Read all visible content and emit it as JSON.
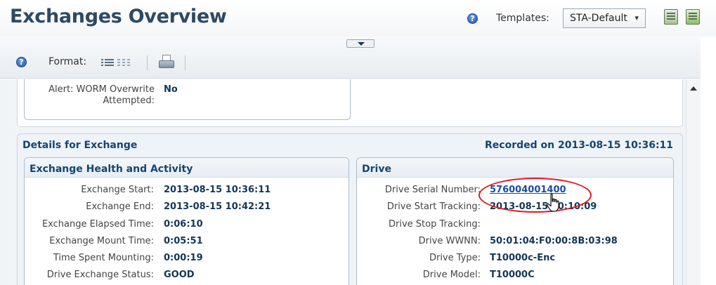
{
  "header": {
    "title": "Exchanges Overview",
    "help_icon": "question-circle",
    "templates_label": "Templates:",
    "template_selected": "STA-Default",
    "icons": [
      "report-icon",
      "report-export-icon"
    ]
  },
  "toolbar": {
    "format_label": "Format:",
    "icons": [
      "list-view-icon",
      "grid-view-icon",
      "print-icon"
    ]
  },
  "alert_panel": {
    "label": "Alert: WORM Overwrite Attempted:",
    "value": "No"
  },
  "details": {
    "title": "Details for Exchange",
    "recorded": "Recorded on 2013-08-15 10:36:11",
    "health": {
      "title": "Exchange Health and Activity",
      "rows": [
        {
          "label": "Exchange Start:",
          "value": "2013-08-15 10:36:11"
        },
        {
          "label": "Exchange End:",
          "value": "2013-08-15 10:42:21"
        },
        {
          "label": "Exchange Elapsed Time:",
          "value": "0:06:10"
        },
        {
          "label": "Exchange Mount Time:",
          "value": "0:05:51"
        },
        {
          "label": "Time Spent Mounting:",
          "value": "0:00:19"
        },
        {
          "label": "Drive Exchange Status:",
          "value": "GOOD"
        }
      ]
    },
    "drive": {
      "title": "Drive",
      "rows": [
        {
          "label": "Drive Serial Number:",
          "value": "576004001400"
        },
        {
          "label": "Drive Start Tracking:",
          "value": "2013-08-15 10:10:09"
        },
        {
          "label": "Drive Stop Tracking:",
          "value": ""
        },
        {
          "label": "Drive WWNN:",
          "value": "50:01:04:F0:00:8B:03:98"
        },
        {
          "label": "Drive Type:",
          "value": "T10000c-Enc"
        },
        {
          "label": "Drive Model:",
          "value": "T10000C"
        }
      ]
    }
  },
  "colors": {
    "title": "#2e4a63",
    "section_title": "#15456f",
    "value": "#133657",
    "link": "#1a4f9e",
    "highlight": "#e3161f"
  }
}
